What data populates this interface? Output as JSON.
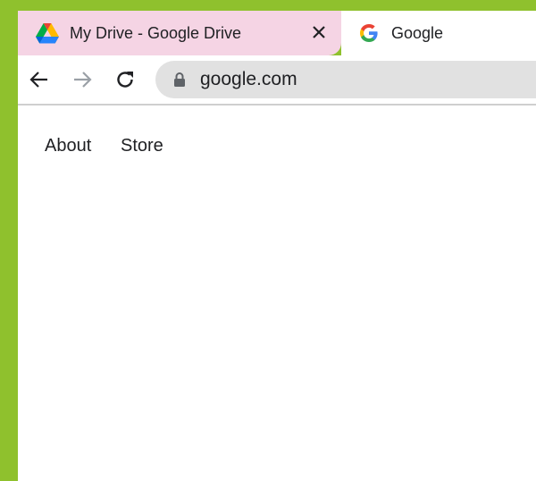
{
  "tabs": [
    {
      "title": "My Drive - Google Drive",
      "icon": "google-drive-icon",
      "active": true
    },
    {
      "title": "Google",
      "icon": "google-g-icon",
      "active": false
    }
  ],
  "toolbar": {
    "back_icon": "arrow-left-icon",
    "forward_icon": "arrow-right-icon",
    "reload_icon": "reload-icon"
  },
  "omnibox": {
    "url": "google.com",
    "lock_icon": "lock-icon"
  },
  "page": {
    "links": [
      "About",
      "Store"
    ]
  },
  "colors": {
    "frame": "#8fc12d",
    "active_tab": "#f5d4e4",
    "omnibox": "#e1e1e1"
  }
}
